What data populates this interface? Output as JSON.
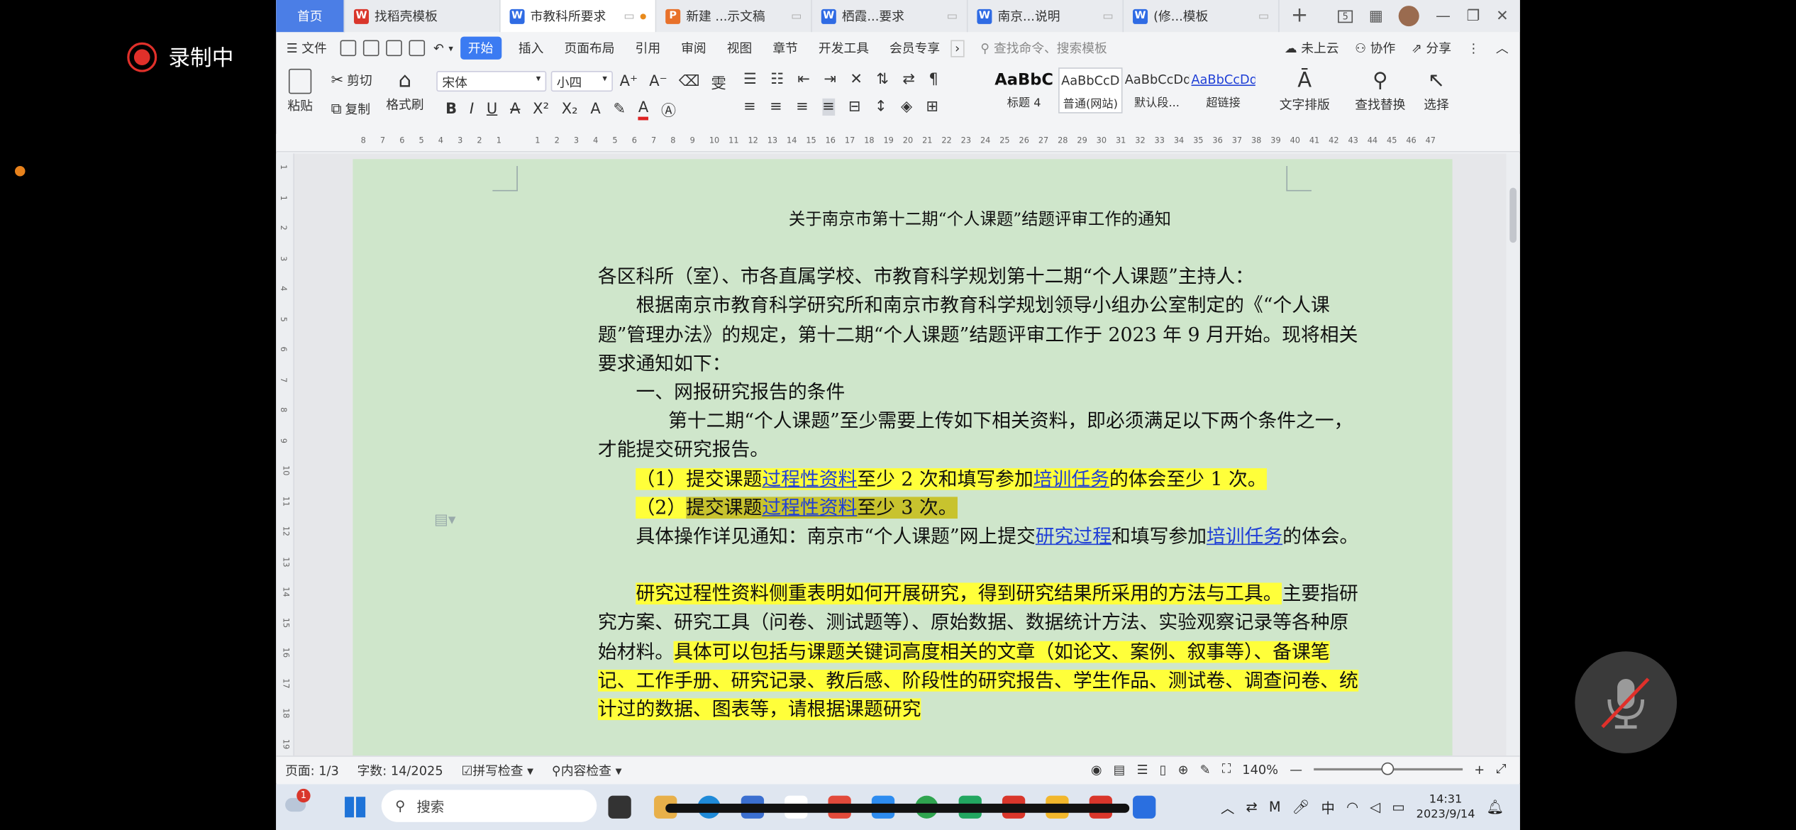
{
  "recording": {
    "label": "录制中"
  },
  "tabs": [
    {
      "label": "首页",
      "type": "home"
    },
    {
      "label": "找稻壳模板",
      "icon_color": "#d9362b",
      "icon_char": "W"
    },
    {
      "label": "市教科所要求",
      "icon_color": "#2f6be4",
      "icon_char": "W",
      "active": true
    },
    {
      "label": "新建 ...示文稿",
      "icon_color": "#e8712a",
      "icon_char": "P"
    },
    {
      "label": "栖霞...要求",
      "icon_color": "#2f6be4",
      "icon_char": "W"
    },
    {
      "label": "南京...说明",
      "icon_color": "#2f6be4",
      "icon_char": "W"
    },
    {
      "label": "(修...模板",
      "icon_color": "#2f6be4",
      "icon_char": "W"
    }
  ],
  "window_controls": {
    "badge": "5"
  },
  "menu": {
    "file": "文件",
    "items": [
      "开始",
      "插入",
      "页面布局",
      "引用",
      "审阅",
      "视图",
      "章节",
      "开发工具",
      "会员专享"
    ],
    "active": "开始",
    "search_placeholder": "查找命令、搜索模板",
    "cloud": "未上云",
    "collab": "协作",
    "share": "分享"
  },
  "ribbon": {
    "paste": "粘贴",
    "cut": "剪切",
    "copy": "复制",
    "format_painter": "格式刷",
    "font_name": "宋体",
    "font_size": "小四",
    "styles": [
      {
        "preview": "AaBbC",
        "label": "标题 4"
      },
      {
        "preview": "AaBbCcD",
        "label": "普通(网站)"
      },
      {
        "preview": "AaBbCcDd",
        "label": "默认段..."
      },
      {
        "preview": "AaBbCcDd",
        "label": "超链接"
      }
    ],
    "text_layout": "文字排版",
    "find_replace": "查找替换",
    "select": "选择"
  },
  "ruler_labels": [
    "8",
    "7",
    "6",
    "5",
    "4",
    "3",
    "2",
    "1",
    "",
    "1",
    "2",
    "3",
    "4",
    "5",
    "6",
    "7",
    "8",
    "9",
    "10",
    "11",
    "12",
    "13",
    "14",
    "15",
    "16",
    "17",
    "18",
    "19",
    "20",
    "21",
    "22",
    "23",
    "24",
    "25",
    "26",
    "27",
    "28",
    "29",
    "30",
    "31",
    "32",
    "33",
    "34",
    "35",
    "36",
    "37",
    "38",
    "39",
    "40",
    "41",
    "42",
    "43",
    "44",
    "45",
    "46",
    "47"
  ],
  "vruler_labels": [
    "1",
    "1",
    "2",
    "3",
    "4",
    "5",
    "6",
    "7",
    "8",
    "9",
    "10",
    "11",
    "12",
    "13",
    "14",
    "15",
    "16",
    "17",
    "18",
    "19"
  ],
  "document": {
    "title": "关于南京市第十二期“个人课题”结题评审工作的通知",
    "addressee": "各区科所（室）、市各直属学校、市教育科学规划第十二期“个人课题”主持人：",
    "para1": "根据南京市教育科学研究所和南京市教育科学规划领导小组办公室制定的《“个人课题”管理办法》的规定，第十二期“个人课题”结题评审工作于 2023 年 9 月开始。现将相关要求通知如下：",
    "heading1": "一、网报研究报告的条件",
    "para2": "第十二期“个人课题”至少需要上传如下相关资料，即必须满足以下两个条件之一，才能提交研究报告。",
    "item1": {
      "a": "（1）提交课题",
      "link1": "过程性资料",
      "b": "至少 2 次和填写参加",
      "link2": "培训任务",
      "c": "的体会至少 1 次。"
    },
    "item2": {
      "a": "（2）",
      "b": "提交课题",
      "link": "过程性资料",
      "c": "至少 3 次。"
    },
    "para3": {
      "a": "具体操作详见通知：南京市“个人课题”网上提交",
      "link1": "研究过程",
      "b": "和填写参加",
      "link2": "培训任务",
      "c": "的体会。"
    },
    "para4": {
      "hl": "研究过程性资料侧重表明如何开展研究，得到研究结果所采用的方法与工具。",
      "plain": "主要指研究方案、研究工具（问卷、测试题等）、原始数据、数据统计方法、实验观察记录等各种原始材料。",
      "hl2": "具体可以包括与课题关键词高度相关的文章（如论文、案例、叙事等）、备课笔记、工作手册、研究记录、教后感、阶段性的研究报告、学生作品、测试卷、调查问卷、统计过的数据、图表等，请根据课题研究"
    }
  },
  "status": {
    "page": "页面: 1/3",
    "words": "字数: 14/2025",
    "spell": "拼写检查",
    "content_check": "内容检查",
    "zoom": "140%",
    "zoom_level": 0.5
  },
  "taskbar": {
    "search": "搜索",
    "notif_count": "1",
    "ime": "中",
    "time": "14:31",
    "date": "2023/9/14"
  },
  "colors": {
    "accent": "#3b7bf2",
    "page_bg": "#cfe6cb",
    "highlight": "#ffff3a",
    "link": "#1f3fd6",
    "record": "#e0302a"
  }
}
